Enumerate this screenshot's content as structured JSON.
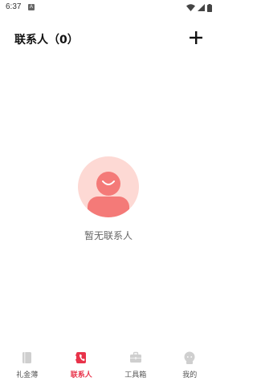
{
  "status": {
    "time": "6:37",
    "notification_badge": "A"
  },
  "header": {
    "title": "联系人（0）"
  },
  "empty_state": {
    "message": "暂无联系人"
  },
  "tabs": [
    {
      "label": "礼金薄",
      "icon": "book-icon",
      "active": false
    },
    {
      "label": "联系人",
      "icon": "contacts-icon",
      "active": true
    },
    {
      "label": "工具箱",
      "icon": "toolbox-icon",
      "active": false
    },
    {
      "label": "我的",
      "icon": "profile-icon",
      "active": false
    }
  ],
  "colors": {
    "accent": "#e8334a",
    "inactive_icon": "#cfcfcf",
    "placeholder_circle": "#fdd9d4"
  }
}
